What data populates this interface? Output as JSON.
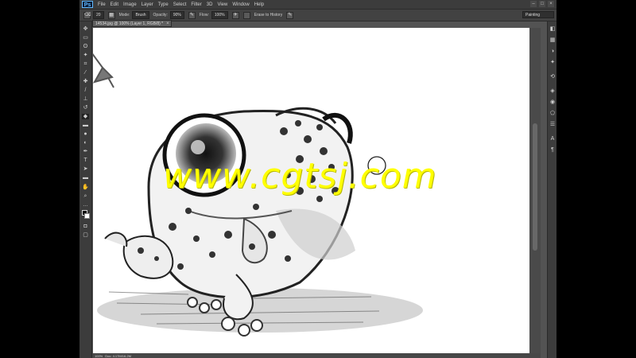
{
  "app": {
    "logo": "Ps",
    "menus": [
      "File",
      "Edit",
      "Image",
      "Layer",
      "Type",
      "Select",
      "Filter",
      "3D",
      "View",
      "Window",
      "Help"
    ],
    "window_controls": [
      "–",
      "□",
      "×"
    ]
  },
  "options": {
    "size_value": "20",
    "mode_label": "Mode:",
    "mode_value": "Brush",
    "opacity_label": "Opacity:",
    "opacity_value": "90%",
    "flow_label": "Flow:",
    "flow_value": "100%",
    "erase_label": "Erase to History",
    "workspace": "Painting"
  },
  "document": {
    "tab_title": "14534.jpg @ 100% (Layer 1, RGB/8) *",
    "close": "×"
  },
  "status": {
    "zoom": "100%",
    "doc_info": "Doc: 4.17M/16.2M"
  },
  "watermark": "www.cgtsj.com",
  "icons": {
    "toolbox": [
      "move-icon",
      "marquee-icon",
      "lasso-icon",
      "quick-select-icon",
      "crop-icon",
      "eyedropper-icon",
      "healing-icon",
      "brush-icon",
      "stamp-icon",
      "history-brush-icon",
      "eraser-icon",
      "gradient-icon",
      "blur-icon",
      "dodge-icon",
      "pen-icon",
      "type-icon",
      "path-select-icon",
      "shape-icon",
      "hand-icon",
      "zoom-icon"
    ],
    "panels": [
      "color-panel-icon",
      "swatches-icon",
      "adjustments-icon",
      "styles-icon",
      "history-icon",
      "layers-icon",
      "channels-icon",
      "paths-icon",
      "properties-icon",
      "character-icon",
      "paragraph-icon"
    ]
  }
}
